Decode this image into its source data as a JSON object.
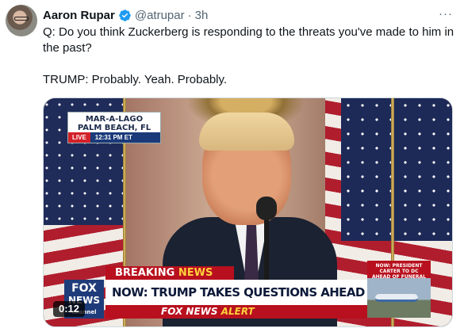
{
  "tweet": {
    "author_name": "Aaron Rupar",
    "handle": "@atrupar",
    "separator": "·",
    "time": "3h",
    "more_label": "···",
    "text_line1": "Q: Do you think Zuckerberg is responding to the threats you've made to him in the past?",
    "text_line2": "TRUMP: Probably. Yeah. Probably."
  },
  "video": {
    "duration": "0:12",
    "location_line1": "MAR-A-LAGO",
    "location_line2": "PALM BEACH, FL",
    "live_label": "LIVE",
    "live_time": "12:31 PM ET",
    "breaking_label": "BREAKING",
    "breaking_news": "NEWS",
    "headline": "NOW: TRUMP TAKES QUESTIONS AHEAD OF SECOND TERM",
    "alert_prefix": "FOX NEWS",
    "alert_word": "ALERT",
    "logo_line1": "FOX",
    "logo_line2": "NEWS",
    "logo_line3": "channel",
    "side_caption": "NOW: PRESIDENT CARTER TO DC AHEAD OF FUNERAL"
  },
  "colors": {
    "verified": "#1d9bf0",
    "fox_red": "#b8101e",
    "fox_blue": "#1b3a7a",
    "alert_yellow": "#ffd23a"
  }
}
